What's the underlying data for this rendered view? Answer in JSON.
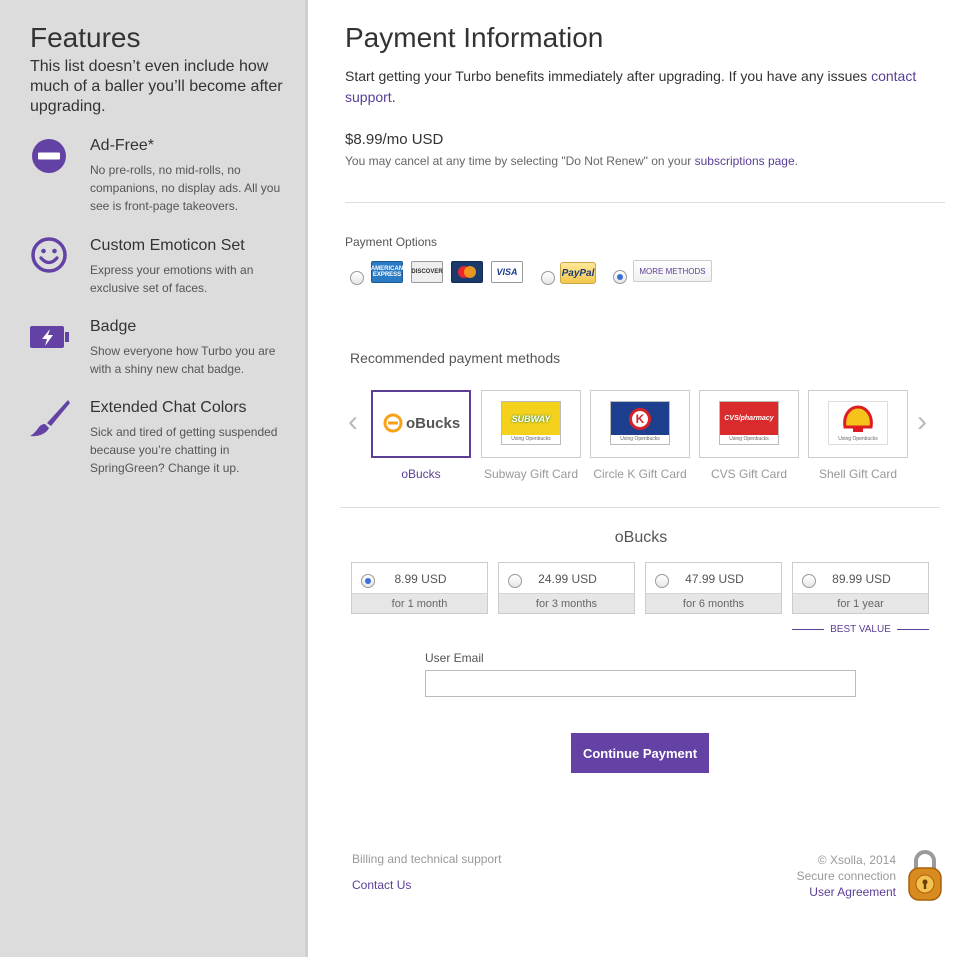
{
  "sidebar": {
    "title": "Features",
    "subtitle": "This list doesn’t even include how much of a baller you’ll become after upgrading.",
    "features": [
      {
        "title": "Ad-Free*",
        "desc": "No pre-rolls, no mid-rolls, no companions, no display ads. All you see is front-page takeovers.",
        "icon": "no-entry-icon"
      },
      {
        "title": "Custom Emoticon Set",
        "desc": "Express your emotions with an exclusive set of faces.",
        "icon": "smiley-icon"
      },
      {
        "title": "Badge",
        "desc": "Show everyone how Turbo you are with a shiny new chat badge.",
        "icon": "battery-bolt-icon"
      },
      {
        "title": "Extended Chat Colors",
        "desc": "Sick and tired of getting suspended because you’re chatting in SpringGreen? Change it up.",
        "icon": "paintbrush-icon"
      }
    ]
  },
  "main": {
    "title": "Payment Information",
    "intro": "Start getting your Turbo benefits immediately after upgrading. If you have any issues ",
    "intro_link": "contact support",
    "intro_end": ".",
    "price": "$8.99/mo USD",
    "cancel_text": "You may cancel at any time by selecting \"Do Not Renew\" on your ",
    "cancel_link": "subscriptions page",
    "cancel_end": "."
  },
  "payment_options": {
    "label": "Payment Options",
    "cards": [
      "AMERICAN EXPRESS",
      "DISCOVER",
      "MasterCard",
      "VISA"
    ],
    "paypal": "PayPal",
    "more_methods": "MORE METHODS"
  },
  "recommended": {
    "title": "Recommended payment methods",
    "prev_arrow": "‹",
    "next_arrow": "›",
    "methods": [
      {
        "label": "oBucks",
        "logo": "oBucks"
      },
      {
        "label": "Subway Gift Card",
        "logo": "SUBWAY"
      },
      {
        "label": "Circle K Gift Card",
        "logo": "K"
      },
      {
        "label": "CVS Gift Card",
        "logo": "CVS/pharmacy"
      },
      {
        "label": "Shell Gift Card",
        "logo": "Shell"
      }
    ],
    "card_caption": "Using Openbucks"
  },
  "obucks": {
    "title": "oBucks",
    "amounts": [
      {
        "value": "8.99 USD",
        "period": "for 1 month"
      },
      {
        "value": "24.99 USD",
        "period": "for 3 months"
      },
      {
        "value": "47.99 USD",
        "period": "for 6 months"
      },
      {
        "value": "89.99 USD",
        "period": "for 1 year"
      }
    ],
    "best_value": "BEST VALUE"
  },
  "form": {
    "email_label": "User Email",
    "email_value": "",
    "continue_label": "Continue Payment"
  },
  "footer": {
    "billing": "Billing and technical support",
    "contact": "Contact Us",
    "copyright": "© Xsolla, 2014",
    "secure": "Secure connection",
    "agreement": "User Agreement"
  },
  "colors": {
    "accent": "#6441a4",
    "link": "#5b3e96"
  }
}
